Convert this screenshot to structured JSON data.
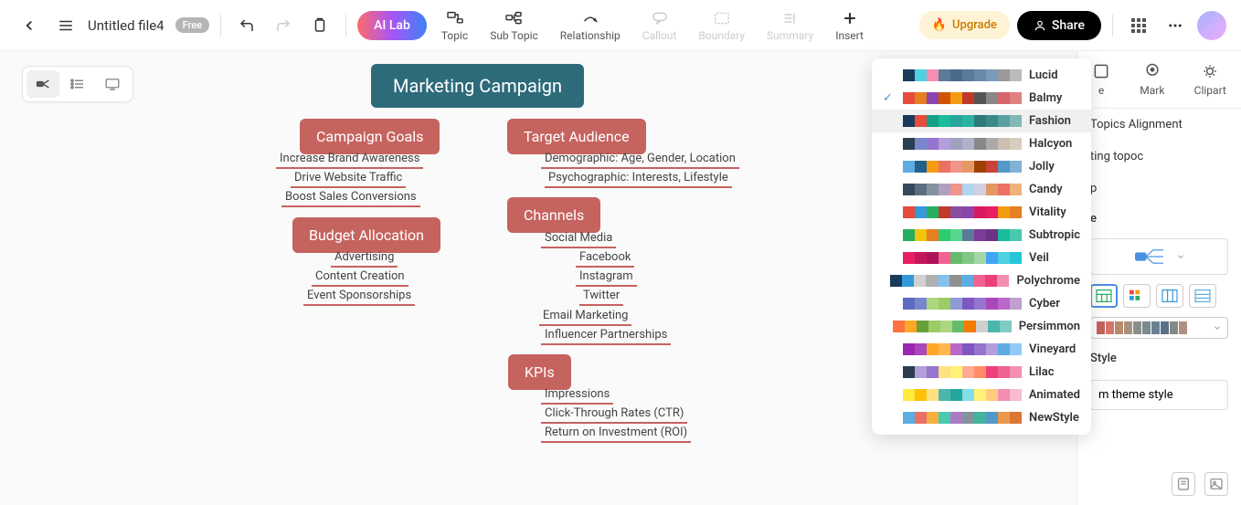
{
  "header": {
    "filename": "Untitled file4",
    "badge": "Free",
    "ai_lab": "AI Lab",
    "tools": [
      {
        "label": "Topic",
        "enabled": true
      },
      {
        "label": "Sub Topic",
        "enabled": true
      },
      {
        "label": "Relationship",
        "enabled": true
      },
      {
        "label": "Callout",
        "enabled": false
      },
      {
        "label": "Boundary",
        "enabled": false
      },
      {
        "label": "Summary",
        "enabled": false
      },
      {
        "label": "Insert",
        "enabled": true
      }
    ],
    "upgrade": "Upgrade",
    "share": "Share"
  },
  "mindmap": {
    "root": "Marketing Campaign",
    "b1": {
      "title": "Campaign Goals",
      "items": [
        "Increase Brand Awareness",
        "Drive Website Traffic",
        "Boost Sales Conversions"
      ]
    },
    "b2": {
      "title": "Target Audience",
      "items": [
        "Demographic: Age, Gender, Location",
        "Psychographic: Interests, Lifestyle"
      ]
    },
    "b3": {
      "title": "Budget Allocation",
      "items": [
        "Advertising",
        "Content Creation",
        "Event Sponsorships"
      ]
    },
    "b4": {
      "title": "Channels",
      "items": [
        "Social Media",
        "Email Marketing",
        "Influencer Partnerships"
      ],
      "sub": [
        "Facebook",
        "Instagram",
        "Twitter"
      ]
    },
    "b5": {
      "title": "KPIs",
      "items": [
        "Impressions",
        "Click-Through Rates (CTR)",
        "Return on Investment (ROI)"
      ]
    }
  },
  "palettes": [
    {
      "name": "Lucid",
      "colors": [
        "#1a3a5c",
        "#4dd0e1",
        "#f48fb1",
        "#5c7a99",
        "#4a6a8a",
        "#5a7a9a",
        "#6a8aaa",
        "#7a9aba",
        "#999999",
        "#bbbbbb"
      ],
      "selected": false
    },
    {
      "name": "Balmy",
      "colors": [
        "#e74c3c",
        "#e67e22",
        "#8e44ad",
        "#d35400",
        "#f39c12",
        "#c0392b",
        "#555555",
        "#888888",
        "#d6666a",
        "#e08080"
      ],
      "selected": true
    },
    {
      "name": "Fashion",
      "colors": [
        "#1a3a5c",
        "#e74c3c",
        "#16a085",
        "#1abc9c",
        "#26a69a",
        "#2bb4a0",
        "#2d7a7a",
        "#3a8a8a",
        "#5aa0a0",
        "#80b8b8"
      ],
      "selected": false,
      "highlight": true
    },
    {
      "name": "Halcyon",
      "colors": [
        "#2c3e50",
        "#7986cb",
        "#9575cd",
        "#b39ddb",
        "#a0a0c0",
        "#b0b0c8",
        "#888888",
        "#aaaaaa",
        "#ccc0b0",
        "#d8ccc0"
      ],
      "selected": false
    },
    {
      "name": "Jolly",
      "colors": [
        "#5dade2",
        "#21618c",
        "#f39c12",
        "#ec7063",
        "#f1948a",
        "#e59866",
        "#a04000",
        "#cb4335",
        "#5499c7",
        "#7fb3d5"
      ],
      "selected": false
    },
    {
      "name": "Candy",
      "colors": [
        "#34495e",
        "#5d6d7e",
        "#85929e",
        "#b0a0c0",
        "#f1948a",
        "#aed6f1",
        "#d0d0e0",
        "#e59866",
        "#ec7063",
        "#f0b27a"
      ],
      "selected": false
    },
    {
      "name": "Vitality",
      "colors": [
        "#e74c3c",
        "#3498db",
        "#27ae60",
        "#c0392b",
        "#884ea0",
        "#8e44ad",
        "#d81b60",
        "#e91e63",
        "#f39c12",
        "#e67e22"
      ],
      "selected": false
    },
    {
      "name": "Subtropic",
      "colors": [
        "#27ae60",
        "#f1c40f",
        "#e67e22",
        "#2ecc71",
        "#58d68d",
        "#5a7a9a",
        "#7d3c98",
        "#6c3483",
        "#1abc9c",
        "#48c9b0"
      ],
      "selected": false
    },
    {
      "name": "Veil",
      "colors": [
        "#e91e63",
        "#c2185b",
        "#ad1457",
        "#f06292",
        "#66bb6a",
        "#81c784",
        "#a5d6a7",
        "#42a5f5",
        "#4dd0e1",
        "#26c6da"
      ],
      "selected": false
    },
    {
      "name": "Polychrome",
      "colors": [
        "#1a3a5c",
        "#3498db",
        "#d0d0d0",
        "#b0b0b0",
        "#85c1e9",
        "#909090",
        "#5dade2",
        "#f06292",
        "#ec407a",
        "#f48fb1"
      ],
      "selected": false
    },
    {
      "name": "Cyber",
      "colors": [
        "#5c6bc0",
        "#7986cb",
        "#aed581",
        "#9ccc65",
        "#8e9bd8",
        "#7e57c2",
        "#9575cd",
        "#ab47bc",
        "#ba68c8",
        "#c0a0d0"
      ],
      "selected": false
    },
    {
      "name": "Persimmon",
      "colors": [
        "#ff7043",
        "#ffa726",
        "#689f38",
        "#9ccc65",
        "#aed581",
        "#66bb6a",
        "#f57c00",
        "#d0d0d0",
        "#4db6ac",
        "#80cbc4"
      ],
      "selected": false
    },
    {
      "name": "Vineyard",
      "colors": [
        "#9c27b0",
        "#ab47bc",
        "#ffa726",
        "#ffb74d",
        "#ba68c8",
        "#7e57c2",
        "#9575cd",
        "#b39ddb",
        "#5dade2",
        "#90caf9"
      ],
      "selected": false
    },
    {
      "name": "Lilac",
      "colors": [
        "#2c3e50",
        "#b39ddb",
        "#9575cd",
        "#ffe082",
        "#fff176",
        "#ffab91",
        "#ff8a65",
        "#ec407a",
        "#f06292",
        "#f48fb1"
      ],
      "selected": false
    },
    {
      "name": "Animated",
      "colors": [
        "#ffeb3b",
        "#ffc107",
        "#ffe082",
        "#4db6ac",
        "#26a69a",
        "#80deea",
        "#fff176",
        "#ffcc80",
        "#f48fb1",
        "#f8bbd0"
      ],
      "selected": false
    },
    {
      "name": "NewStyle",
      "colors": [
        "#5dade2",
        "#ec7063",
        "#f5b041",
        "#48c9b0",
        "#af7ac5",
        "#85929e",
        "#45b39d",
        "#5499c7",
        "#eb984e",
        "#dc7633"
      ],
      "selected": false
    }
  ],
  "rightpanel": {
    "mark": "Mark",
    "clipart": "Clipart",
    "topics_align": "Topics Alignment",
    "ting": "ting topoc",
    "p": "p",
    "e": "e",
    "style": "Style",
    "custom": "m theme style",
    "strip_colors": [
      "#c5635f",
      "#d4756f",
      "#bb8a6a",
      "#a89080",
      "#8a9088",
      "#7a8a90",
      "#6a8090",
      "#5a7088",
      "#888888",
      "#b09080"
    ]
  }
}
